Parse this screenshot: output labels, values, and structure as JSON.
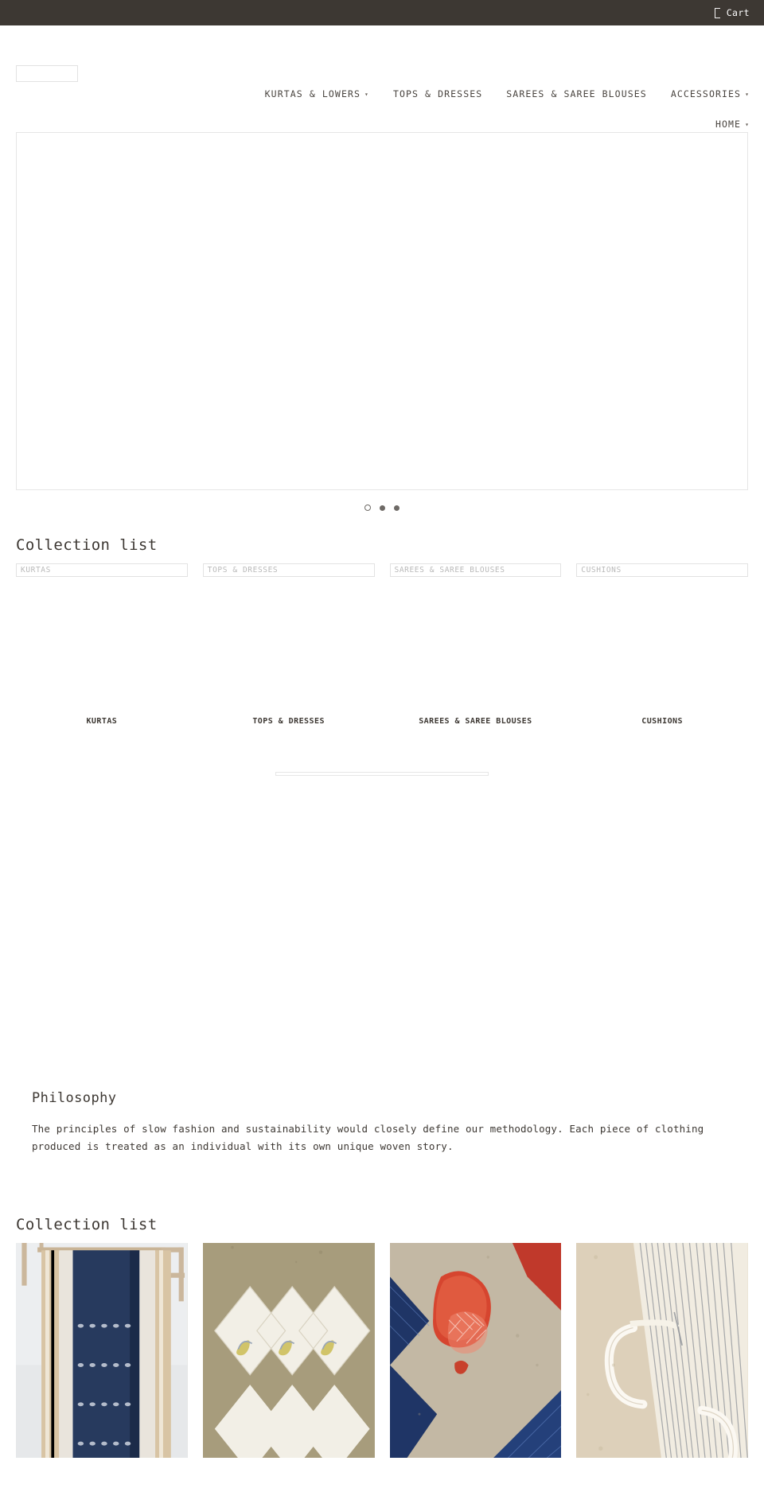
{
  "utility_bar": {
    "cart_label": "Cart",
    "cart_icon": "shopping-bag-icon",
    "background": "#3d3833"
  },
  "header": {
    "logo_alt": "",
    "nav": {
      "row1": [
        {
          "label": "KURTAS & LOWERS",
          "has_dropdown": true
        },
        {
          "label": "TOPS & DRESSES",
          "has_dropdown": false
        },
        {
          "label": "SAREES & SAREE BLOUSES",
          "has_dropdown": false
        },
        {
          "label": "ACCESSORIES",
          "has_dropdown": true
        }
      ],
      "row2": [
        {
          "label": "HOME",
          "has_dropdown": true
        }
      ],
      "caret_glyph": "▾"
    }
  },
  "hero": {
    "alt_text": "",
    "dots": [
      {
        "active": true
      },
      {
        "active": false
      },
      {
        "active": false
      }
    ]
  },
  "collection_list_top": {
    "title": "Collection list",
    "items": [
      {
        "alt": "KURTAS",
        "caption": "KURTAS"
      },
      {
        "alt": "TOPS & DRESSES",
        "caption": "TOPS & DRESSES"
      },
      {
        "alt": "SAREES & SAREE BLOUSES",
        "caption": "SAREES & SAREE BLOUSES"
      },
      {
        "alt": "CUSHIONS",
        "caption": "CUSHIONS"
      }
    ]
  },
  "philosophy": {
    "title": "Philosophy",
    "body": "The principles of slow fashion and sustainability would closely define our methodology. Each piece of clothing produced is treated as an individual with its own unique woven story."
  },
  "collection_list_bottom": {
    "title": "Collection list",
    "items": [
      {
        "image_name": "navy-saree-on-rack-photo"
      },
      {
        "image_name": "cream-napkins-paisley-photo"
      },
      {
        "image_name": "red-and-blue-napkins-photo"
      },
      {
        "image_name": "striped-textile-with-loops-photo"
      }
    ]
  },
  "colors": {
    "utility_bar_bg": "#3d3833",
    "text": "#3d3833",
    "muted_text": "#b9b9b9",
    "border": "#e2e2e2"
  }
}
